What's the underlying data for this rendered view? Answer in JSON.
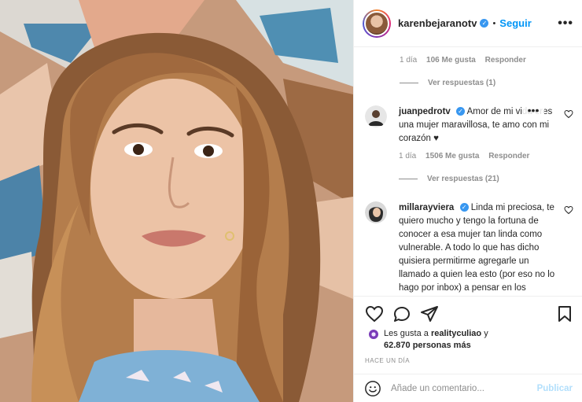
{
  "photo": {
    "alt_icon": "selfie-photo"
  },
  "header": {
    "username": "karenbejaranotv",
    "verified": "✓",
    "separator": "•",
    "follow": "Seguir",
    "more": "•••"
  },
  "comments": {
    "top_meta": {
      "time": "1 día",
      "likes": "106 Me gusta",
      "reply": "Responder"
    },
    "top_view_replies": "Ver respuestas (1)",
    "items": [
      {
        "username": "juanpedrotv",
        "text": "Amor de mi vida eres una mujer maravillosa, te amo con mi corazón ♥",
        "time": "1 día",
        "likes": "1506 Me gusta",
        "reply": "Responder",
        "view_replies": "Ver respuestas (21)",
        "more": "•••"
      },
      {
        "username": "millarayviera",
        "text": "Linda mi preciosa, te quiero mucho y tengo la fortuna de conocer a esa mujer tan linda como vulnerable. A todo lo que has dicho quisiera permitirme agregarle un llamado a quien lea esto (por eso no lo hago por inbox) a pensar en los"
      }
    ]
  },
  "likes": {
    "prefix": "Les gusta a",
    "user": "realityculiao",
    "suffix": "y",
    "count": "62.870 personas más"
  },
  "time": "HACE UN DÍA",
  "add_comment": {
    "placeholder": "Añade un comentario...",
    "publish": "Publicar"
  },
  "colors": {
    "accent": "#0095f6",
    "verified": "#3897f0",
    "muted": "#8e8e8e",
    "publish_disabled": "#b2dffc"
  }
}
